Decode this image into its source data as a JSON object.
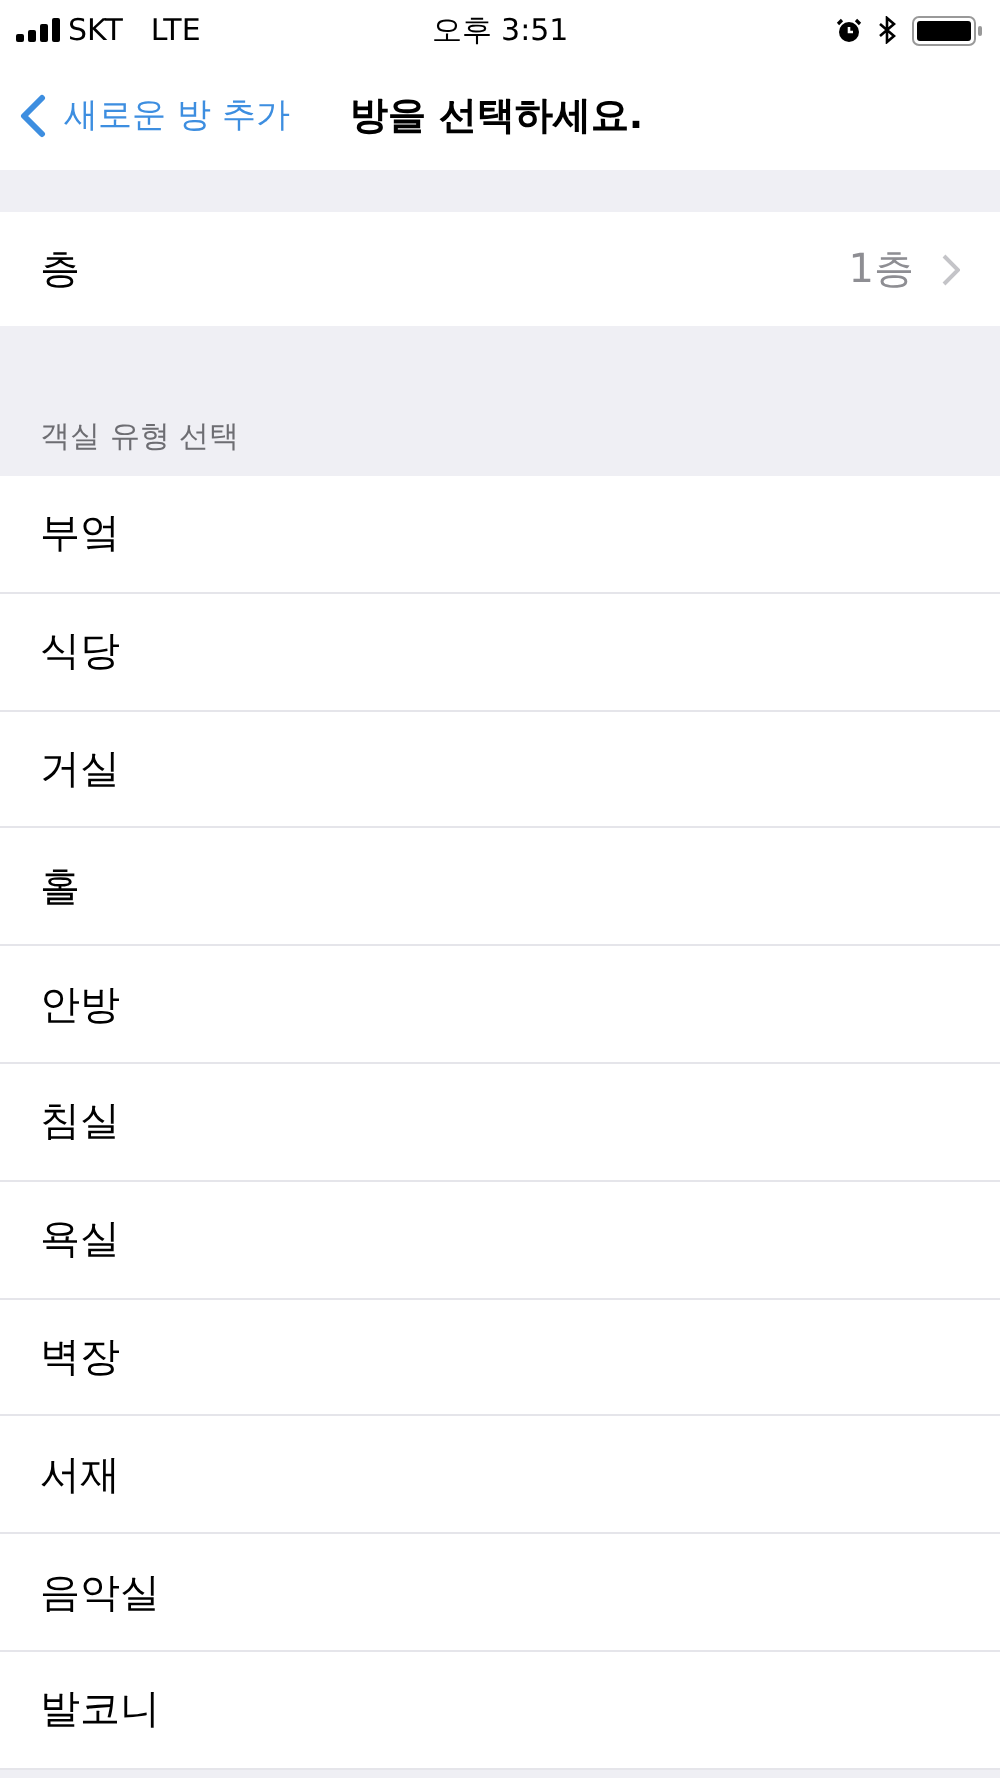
{
  "status_bar": {
    "carrier": "SKT",
    "network": "LTE",
    "time": "오후 3:51"
  },
  "nav": {
    "back": "새로운 방 추가",
    "title": "방을 선택하세요."
  },
  "floor": {
    "label": "층",
    "value": "1층"
  },
  "section_header": "객실 유형 선택",
  "rooms": [
    "부엌",
    "식당",
    "거실",
    "홀",
    "안방",
    "침실",
    "욕실",
    "벽장",
    "서재",
    "음악실",
    "발코니"
  ]
}
